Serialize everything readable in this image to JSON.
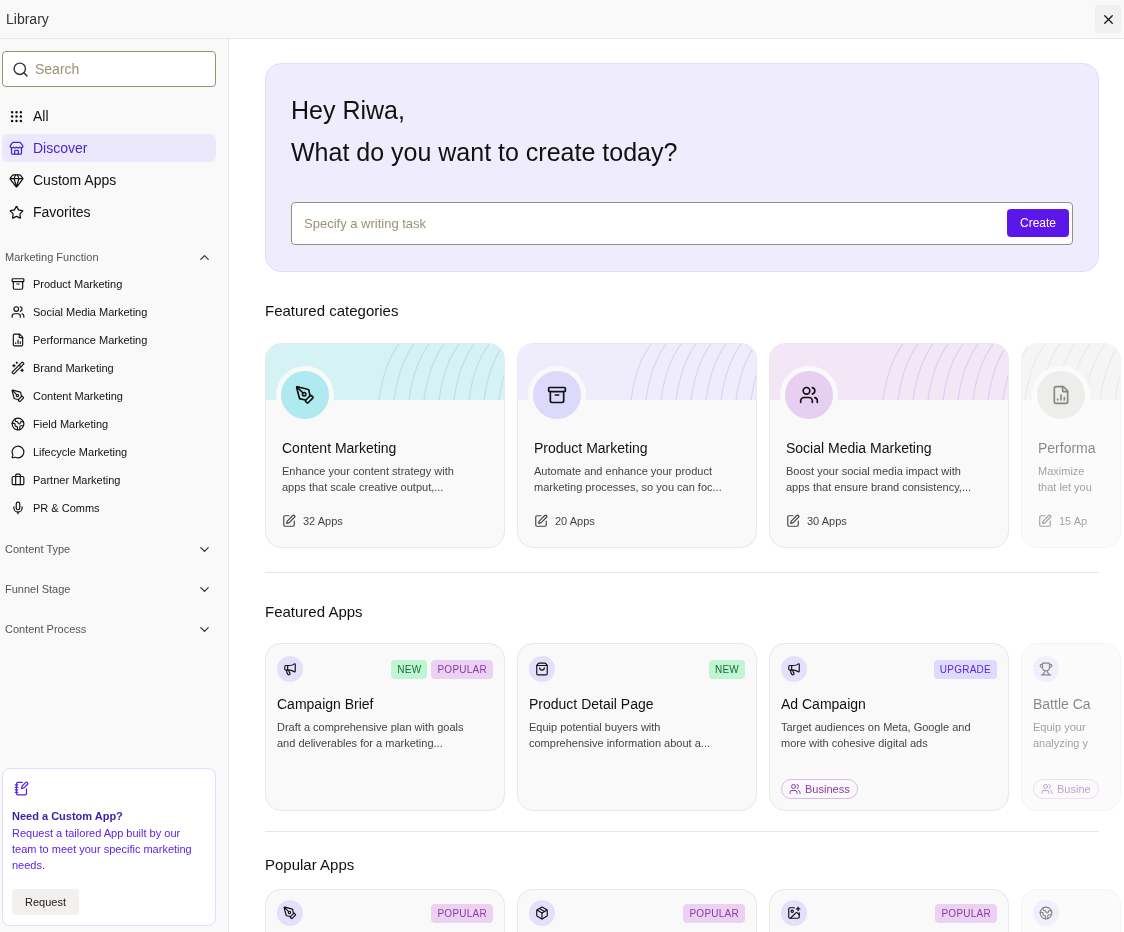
{
  "window": {
    "title": "Library"
  },
  "sidebar": {
    "search": {
      "placeholder": "Search"
    },
    "nav": [
      {
        "label": "All",
        "selected": false
      },
      {
        "label": "Discover",
        "selected": true
      },
      {
        "label": "Custom Apps",
        "selected": false
      },
      {
        "label": "Favorites",
        "selected": false
      }
    ],
    "sections": [
      {
        "title": "Marketing Function",
        "expanded": true,
        "items": [
          "Product Marketing",
          "Social Media Marketing",
          "Performance Marketing",
          "Brand Marketing",
          "Content Marketing",
          "Field Marketing",
          "Lifecycle Marketing",
          "Partner Marketing",
          "PR & Comms"
        ]
      },
      {
        "title": "Content Type",
        "expanded": false
      },
      {
        "title": "Funnel Stage",
        "expanded": false
      },
      {
        "title": "Content Process",
        "expanded": false
      }
    ],
    "promo": {
      "title": "Need a Custom App?",
      "text": "Request a tailored App built by our team to meet your specific marketing needs.",
      "button": "Request"
    }
  },
  "hero": {
    "greeting": "Hey Riwa,",
    "question": "What do you want to create today?",
    "input": {
      "placeholder": "Specify a writing task"
    },
    "button": "Create"
  },
  "featured_categories": {
    "title": "Featured categories",
    "cards": [
      {
        "title": "Content Marketing",
        "description": [
          "Enhance your content strategy with",
          "apps that scale creative output,..."
        ],
        "count": "32 Apps",
        "faded": false
      },
      {
        "title": "Product Marketing",
        "description": [
          "Automate and enhance your product",
          "marketing processes, so you can foc..."
        ],
        "count": "20 Apps",
        "faded": false
      },
      {
        "title": "Social Media Marketing",
        "description": [
          "Boost your social media impact with",
          "apps that ensure brand consistency,..."
        ],
        "count": "30 Apps",
        "faded": false
      },
      {
        "title": "Performa",
        "description": [
          "Maximize",
          "that let you"
        ],
        "count": "15 Ap",
        "faded": true
      }
    ]
  },
  "featured_apps": {
    "title": "Featured Apps",
    "cards": [
      {
        "title": "Campaign Brief",
        "description": [
          "Draft a comprehensive plan with goals",
          "and deliverables for a marketing..."
        ],
        "badges": [
          {
            "kind": "new",
            "label": "NEW"
          },
          {
            "kind": "popular",
            "label": "POPULAR"
          }
        ],
        "faded": false
      },
      {
        "title": "Product Detail Page",
        "description": [
          "Equip potential buyers with",
          "comprehensive information about a..."
        ],
        "badges": [
          {
            "kind": "new",
            "label": "NEW"
          }
        ],
        "faded": false
      },
      {
        "title": "Ad Campaign",
        "description": [
          "Target audiences on Meta, Google and",
          "more with cohesive digital ads"
        ],
        "badges": [
          {
            "kind": "upgrade",
            "label": "UPGRADE"
          }
        ],
        "plan": "Business",
        "faded": false
      },
      {
        "title": "Battle Ca",
        "description": [
          "Equip your",
          "analyzing y"
        ],
        "plan": "Busine",
        "faded": true
      }
    ]
  },
  "popular_apps": {
    "title": "Popular Apps",
    "cards": [
      {
        "badges": [
          {
            "kind": "popular",
            "label": "POPULAR"
          }
        ],
        "faded": false
      },
      {
        "badges": [
          {
            "kind": "popular",
            "label": "POPULAR"
          }
        ],
        "faded": false
      },
      {
        "badges": [
          {
            "kind": "popular",
            "label": "POPULAR"
          }
        ],
        "faded": false
      },
      {
        "faded": true
      }
    ]
  }
}
